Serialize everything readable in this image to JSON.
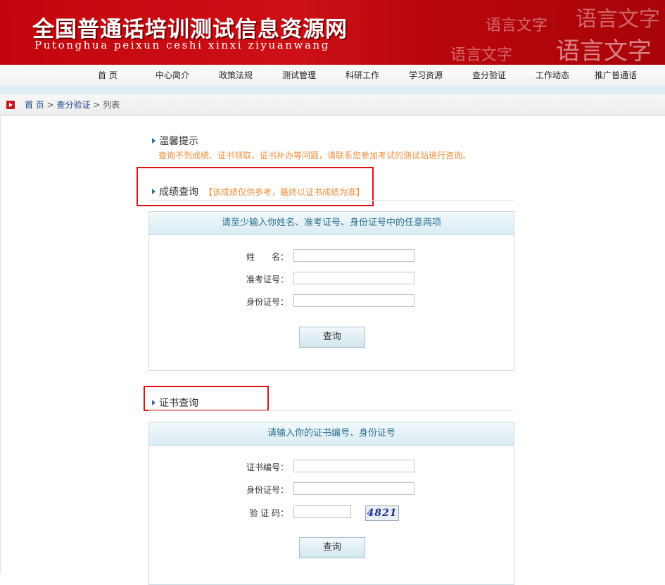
{
  "banner": {
    "title": "全国普通话培训测试信息资源网",
    "subtitle": "Putonghua peixun ceshi xinxi ziyuanwang",
    "deco1": "语言文字",
    "deco2": "语言文字",
    "deco3": "语言文字",
    "deco4": "语言文字"
  },
  "nav": {
    "items": [
      "首 页",
      "中心简介",
      "政策法规",
      "测试管理",
      "科研工作",
      "学习资源",
      "查分验证",
      "工作动态",
      "推广普通话"
    ]
  },
  "breadcrumb": {
    "home": "首 页",
    "sep1": ">",
    "section": "查分验证",
    "sep2": ">",
    "current": "列表"
  },
  "tips": {
    "title": "温馨提示",
    "text": "查询不到成绩、证书领取、证书补办等问题，请联系您参加考试的测试站进行咨询。"
  },
  "score_query": {
    "title": "成绩查询",
    "note": "【该成绩仅供参考，最终以证书成绩为准】",
    "panel_title": "请至少输入你姓名、准考证号、身份证号中的任意两项",
    "name_label": "姓　　名：",
    "ticket_label": "准考证号：",
    "id_label": "身份证号：",
    "submit": "查询"
  },
  "cert_query": {
    "title": "证书查询",
    "panel_title": "请输入你的证书编号、身份证号",
    "cert_label": "证书编号：",
    "id_label": "身份证号：",
    "captcha_label": "验 证 码：",
    "captcha_text": "4821",
    "submit": "查询"
  }
}
